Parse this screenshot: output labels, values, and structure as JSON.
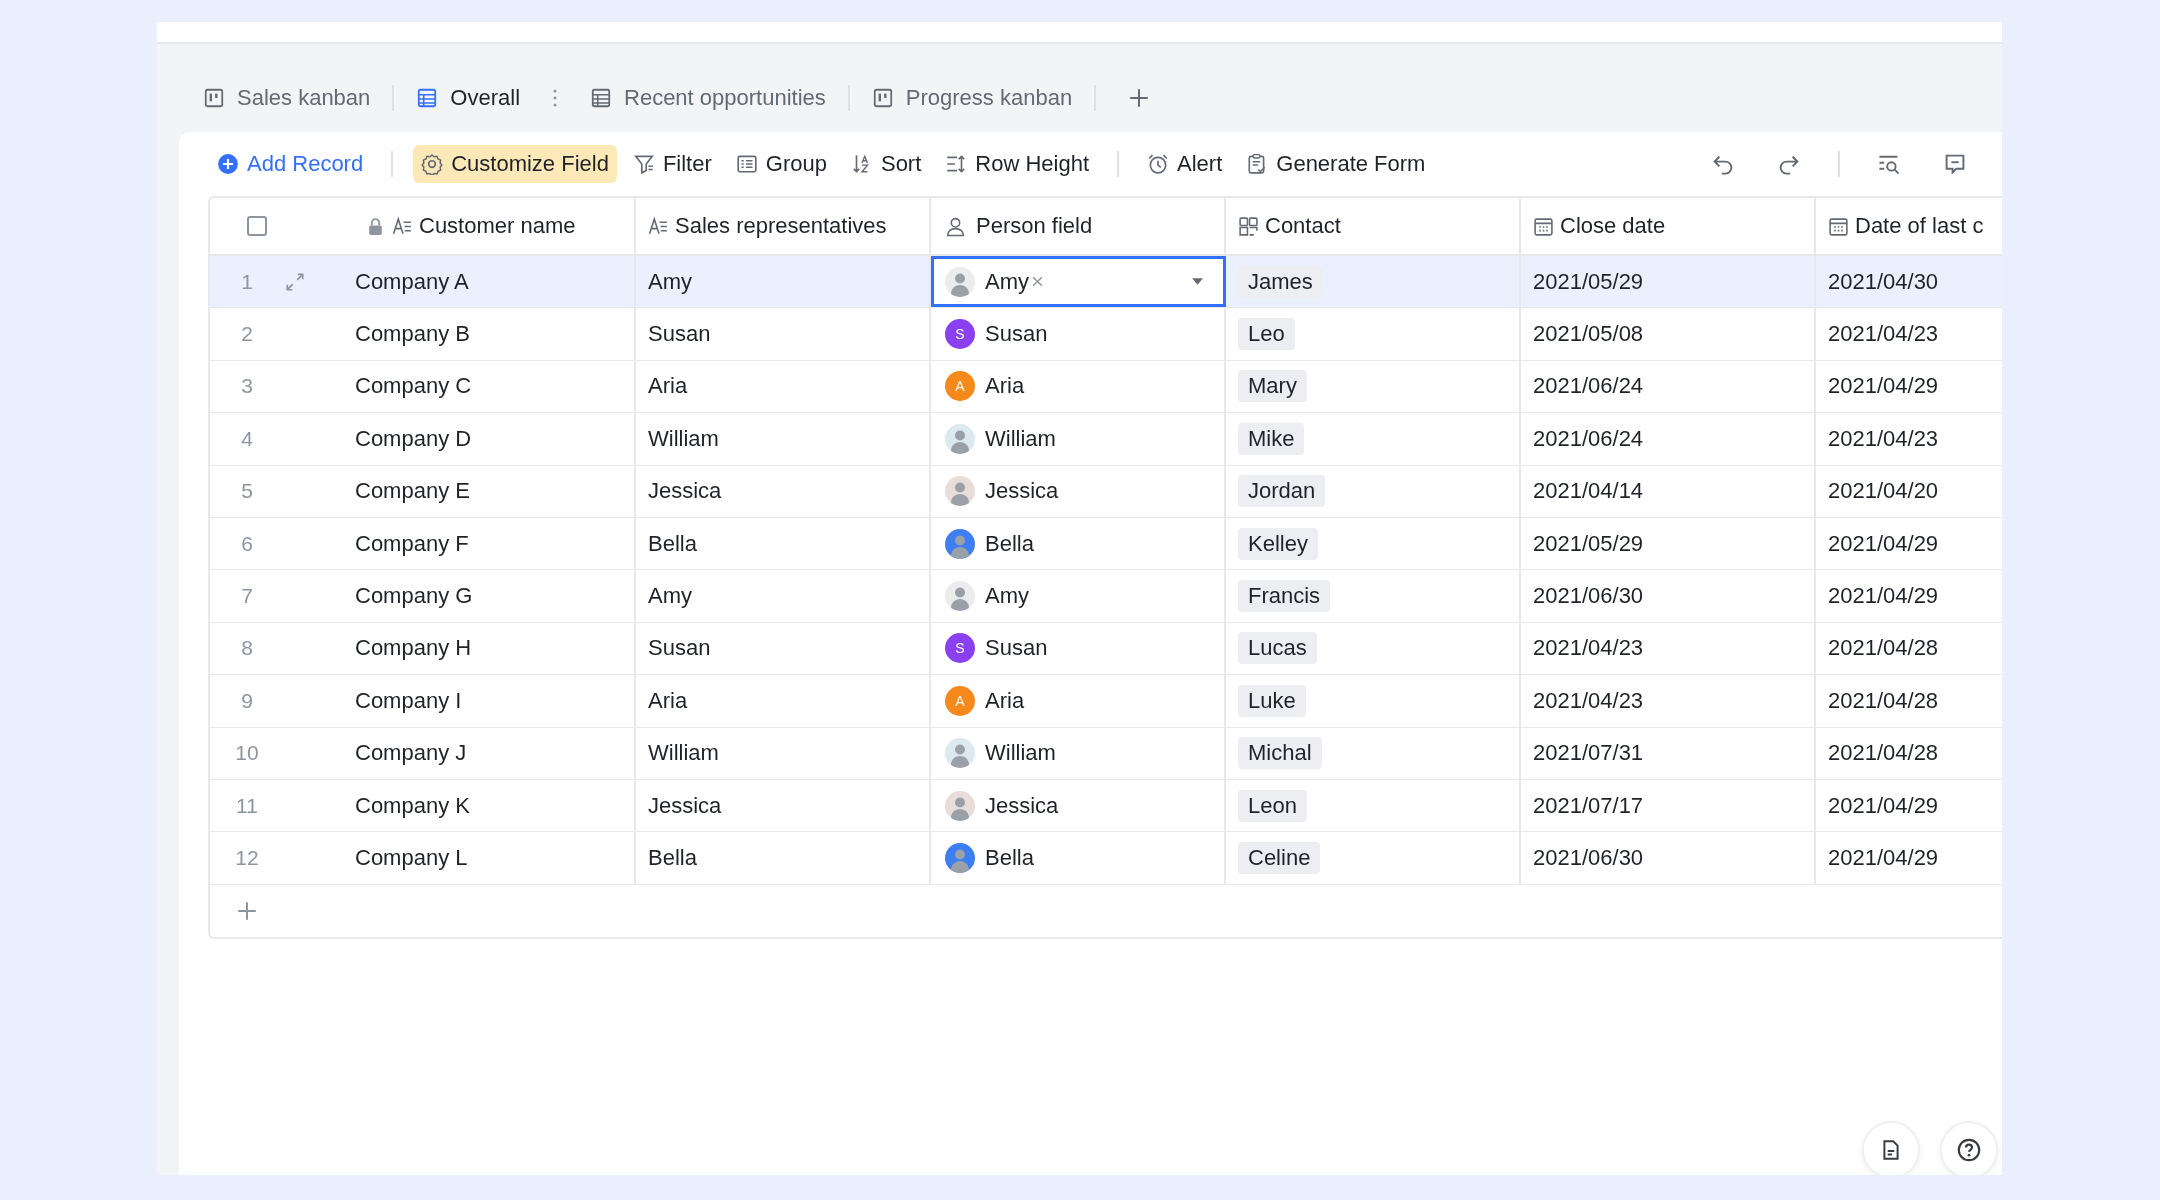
{
  "tabs": [
    {
      "label": "Sales kanban",
      "kind": "kanban",
      "selected": false
    },
    {
      "label": "Overall",
      "kind": "grid",
      "selected": true
    },
    {
      "label": "Recent opportunities",
      "kind": "grid",
      "selected": false
    },
    {
      "label": "Progress kanban",
      "kind": "kanban",
      "selected": false
    }
  ],
  "toolbar": {
    "add_record": "Add Record",
    "buttons": [
      {
        "label": "Customize Field",
        "kind": "gear",
        "highlighted": true
      },
      {
        "label": "Filter",
        "kind": "filter",
        "highlighted": false
      },
      {
        "label": "Group",
        "kind": "group",
        "highlighted": false
      },
      {
        "label": "Sort",
        "kind": "sort",
        "highlighted": false
      },
      {
        "label": "Row Height",
        "kind": "rowheight",
        "highlighted": false
      },
      {
        "label": "Alert",
        "kind": "alert",
        "highlighted": false
      },
      {
        "label": "Generate Form",
        "kind": "form",
        "highlighted": false
      }
    ]
  },
  "table": {
    "header_checkbox": {
      "checked": false
    },
    "columns": [
      {
        "label": "Customer name",
        "kind": "text",
        "locked": true
      },
      {
        "label": "Sales representatives",
        "kind": "text",
        "locked": false
      },
      {
        "label": "Person field",
        "kind": "person",
        "locked": false
      },
      {
        "label": "Contact",
        "kind": "link",
        "locked": false
      },
      {
        "label": "Close date",
        "kind": "date",
        "locked": false
      },
      {
        "label": "Date of last c",
        "kind": "date",
        "locked": false
      }
    ],
    "rows": [
      {
        "index": "1",
        "customer": "Company A",
        "rep": "Amy",
        "person": {
          "name": "Amy",
          "kind": "photo",
          "color": "#ececec"
        },
        "contact": "James",
        "close_date": "2021/05/29",
        "last_date": "2021/04/30",
        "selected": true,
        "editing": true
      },
      {
        "index": "2",
        "customer": "Company B",
        "rep": "Susan",
        "person": {
          "name": "Susan",
          "kind": "letter",
          "letter": "S",
          "color": "#8a3ff0"
        },
        "contact": "Leo",
        "close_date": "2021/05/08",
        "last_date": "2021/04/23",
        "selected": false,
        "editing": false
      },
      {
        "index": "3",
        "customer": "Company C",
        "rep": "Aria",
        "person": {
          "name": "Aria",
          "kind": "letter",
          "letter": "A",
          "color": "#f5891b"
        },
        "contact": "Mary",
        "close_date": "2021/06/24",
        "last_date": "2021/04/29",
        "selected": false,
        "editing": false
      },
      {
        "index": "4",
        "customer": "Company D",
        "rep": "William",
        "person": {
          "name": "William",
          "kind": "photo",
          "color": "#dce9ee"
        },
        "contact": "Mike",
        "close_date": "2021/06/24",
        "last_date": "2021/04/23",
        "selected": false,
        "editing": false
      },
      {
        "index": "5",
        "customer": "Company E",
        "rep": "Jessica",
        "person": {
          "name": "Jessica",
          "kind": "photo",
          "color": "#e8ddd8"
        },
        "contact": "Jordan",
        "close_date": "2021/04/14",
        "last_date": "2021/04/20",
        "selected": false,
        "editing": false
      },
      {
        "index": "6",
        "customer": "Company F",
        "rep": "Bella",
        "person": {
          "name": "Bella",
          "kind": "photo",
          "color": "#3d7ff2"
        },
        "contact": "Kelley",
        "close_date": "2021/05/29",
        "last_date": "2021/04/29",
        "selected": false,
        "editing": false
      },
      {
        "index": "7",
        "customer": "Company G",
        "rep": "Amy",
        "person": {
          "name": "Amy",
          "kind": "photo",
          "color": "#ececec"
        },
        "contact": "Francis",
        "close_date": "2021/06/30",
        "last_date": "2021/04/29",
        "selected": false,
        "editing": false
      },
      {
        "index": "8",
        "customer": "Company H",
        "rep": "Susan",
        "person": {
          "name": "Susan",
          "kind": "letter",
          "letter": "S",
          "color": "#8a3ff0"
        },
        "contact": "Lucas",
        "close_date": "2021/04/23",
        "last_date": "2021/04/28",
        "selected": false,
        "editing": false
      },
      {
        "index": "9",
        "customer": "Company I",
        "rep": "Aria",
        "person": {
          "name": "Aria",
          "kind": "letter",
          "letter": "A",
          "color": "#f5891b"
        },
        "contact": "Luke",
        "close_date": "2021/04/23",
        "last_date": "2021/04/28",
        "selected": false,
        "editing": false
      },
      {
        "index": "10",
        "customer": "Company J",
        "rep": "William",
        "person": {
          "name": "William",
          "kind": "photo",
          "color": "#dce9ee"
        },
        "contact": "Michal",
        "close_date": "2021/07/31",
        "last_date": "2021/04/28",
        "selected": false,
        "editing": false
      },
      {
        "index": "11",
        "customer": "Company K",
        "rep": "Jessica",
        "person": {
          "name": "Jessica",
          "kind": "photo",
          "color": "#e8ddd8"
        },
        "contact": "Leon",
        "close_date": "2021/07/17",
        "last_date": "2021/04/29",
        "selected": false,
        "editing": false
      },
      {
        "index": "12",
        "customer": "Company L",
        "rep": "Bella",
        "person": {
          "name": "Bella",
          "kind": "photo",
          "color": "#3d7ff2"
        },
        "contact": "Celine",
        "close_date": "2021/06/30",
        "last_date": "2021/04/29",
        "selected": false,
        "editing": false
      }
    ]
  }
}
